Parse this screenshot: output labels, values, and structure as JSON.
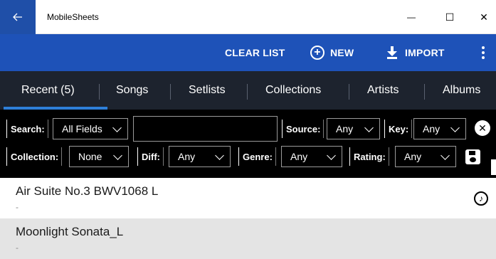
{
  "window": {
    "title": "MobileSheets",
    "back_icon": "arrow-left-icon",
    "minimize_glyph": "—",
    "maximize_glyph": "☐",
    "close_glyph": "✕"
  },
  "appbar": {
    "clear_label": "CLEAR LIST",
    "new_label": "NEW",
    "import_label": "IMPORT",
    "accent_color": "#1e52b8"
  },
  "tabs": [
    {
      "label": "Recent (5)",
      "selected": true
    },
    {
      "label": "Songs"
    },
    {
      "label": "Setlists"
    },
    {
      "label": "Collections"
    },
    {
      "label": "Artists"
    },
    {
      "label": "Albums"
    }
  ],
  "filters": {
    "search_label": "Search:",
    "search_field": "All Fields",
    "search_value": "",
    "source_label": "Source:",
    "source_value": "Any",
    "key_label": "Key:",
    "key_value": "Any",
    "collection_label": "Collection:",
    "collection_value": "None",
    "diff_label": "Diff:",
    "diff_value": "Any",
    "genre_label": "Genre:",
    "genre_value": "Any",
    "rating_label": "Rating:",
    "rating_value": "Any",
    "clear_glyph": "✕"
  },
  "songs": [
    {
      "title": "Air Suite No.3 BWV1068 L",
      "subtitle": "-",
      "icon": "music-note-icon"
    },
    {
      "title": "Moonlight Sonata_L",
      "subtitle": "-"
    }
  ]
}
